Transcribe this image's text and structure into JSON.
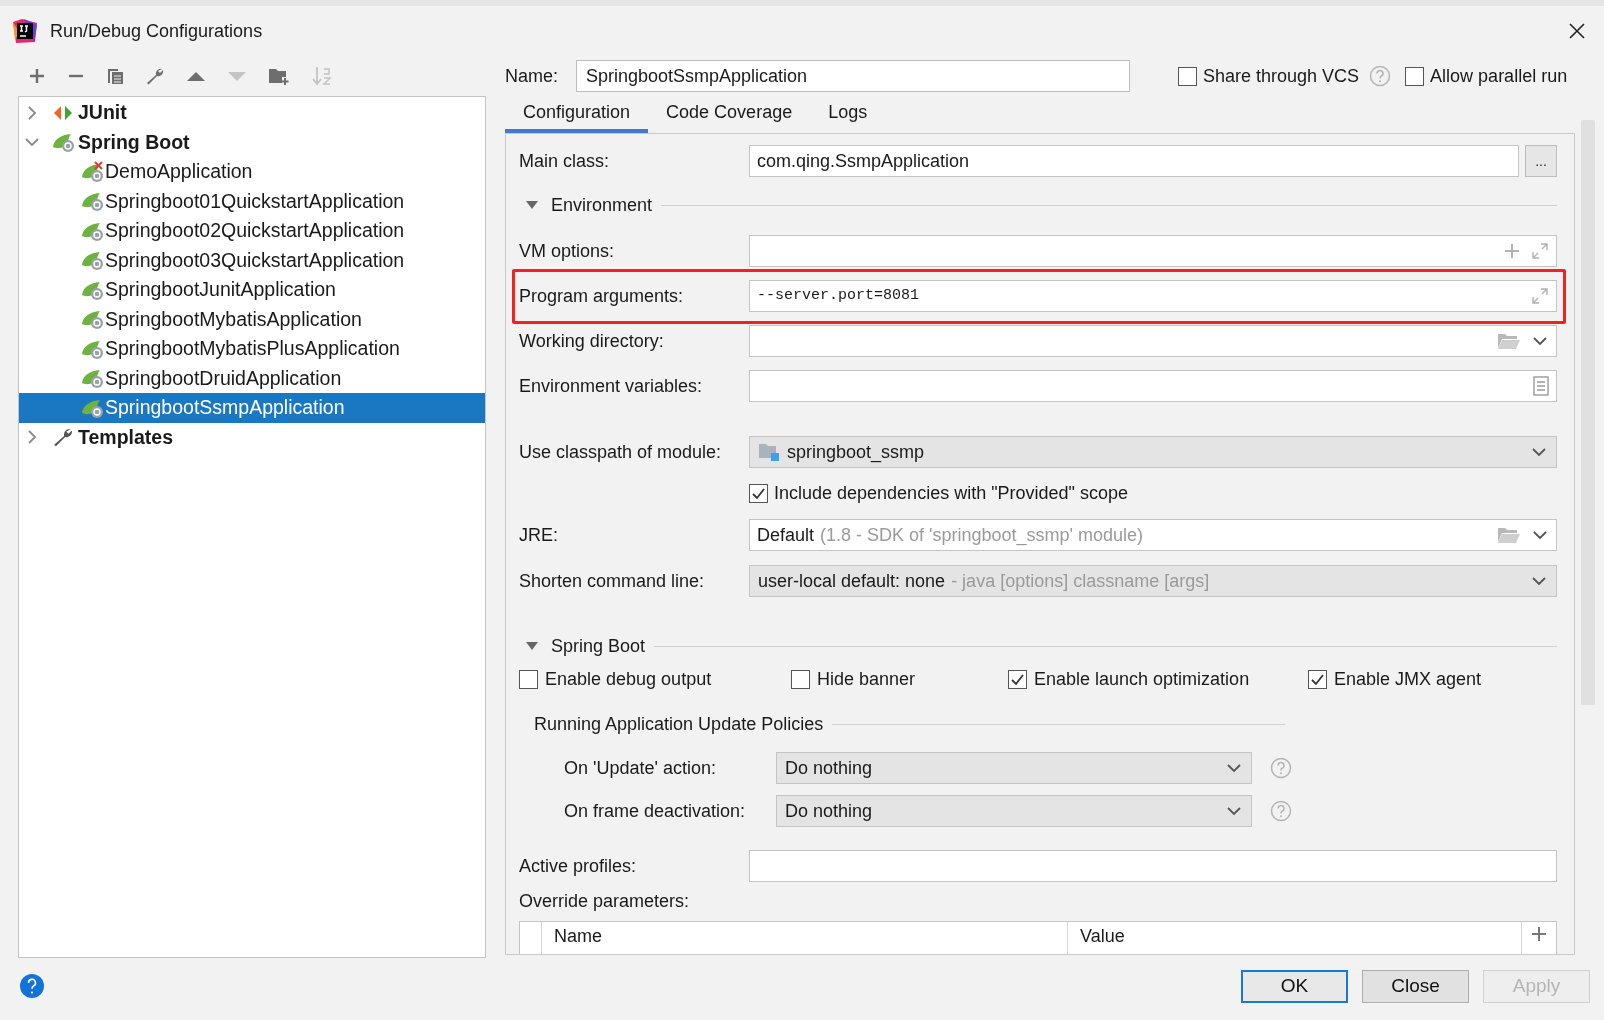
{
  "window": {
    "title": "Run/Debug Configurations"
  },
  "toolbar": [
    {
      "kind": "add",
      "disabled": false
    },
    {
      "kind": "remove",
      "disabled": false
    },
    {
      "kind": "copy",
      "disabled": false
    },
    {
      "kind": "edit",
      "disabled": false
    },
    {
      "kind": "up",
      "disabled": false
    },
    {
      "kind": "down",
      "disabled": true
    },
    {
      "kind": "folder",
      "disabled": false
    },
    {
      "kind": "sort",
      "disabled": true
    }
  ],
  "tree": [
    {
      "label": "JUnit",
      "kind": "junit",
      "expanded": false,
      "selected": false
    },
    {
      "label": "Spring Boot",
      "kind": "spring",
      "expanded": true,
      "selected": false,
      "children": [
        {
          "label": "DemoApplication",
          "error": true,
          "selected": false
        },
        {
          "label": "Springboot01QuickstartApplication",
          "error": false,
          "selected": false
        },
        {
          "label": "Springboot02QuickstartApplication",
          "error": false,
          "selected": false
        },
        {
          "label": "Springboot03QuickstartApplication",
          "error": false,
          "selected": false
        },
        {
          "label": "SpringbootJunitApplication",
          "error": false,
          "selected": false
        },
        {
          "label": "SpringbootMybatisApplication",
          "error": false,
          "selected": false
        },
        {
          "label": "SpringbootMybatisPlusApplication",
          "error": false,
          "selected": false
        },
        {
          "label": "SpringbootDruidApplication",
          "error": false,
          "selected": false
        },
        {
          "label": "SpringbootSsmpApplication",
          "error": false,
          "selected": true
        }
      ]
    },
    {
      "label": "Templates",
      "kind": "templates",
      "expanded": false,
      "selected": false
    }
  ],
  "name": {
    "label": "Name:",
    "value": "SpringbootSsmpApplication"
  },
  "options": [
    {
      "label": "Share through VCS",
      "checked": false,
      "help": true
    },
    {
      "label": "Allow parallel run",
      "checked": false,
      "help": false
    }
  ],
  "tabs": [
    {
      "label": "Configuration",
      "selected": true
    },
    {
      "label": "Code Coverage",
      "selected": false
    },
    {
      "label": "Logs",
      "selected": false
    }
  ],
  "fields": [
    {
      "kind": "text",
      "label": "Main class:",
      "value": "com.qing.SsmpApplication",
      "button": "..."
    },
    {
      "kind": "section",
      "label": "Environment",
      "expanded": true
    },
    {
      "kind": "vm",
      "label": "VM options:"
    },
    {
      "kind": "args",
      "label": "Program arguments:",
      "value": "--server.port=8081",
      "highlighted": true
    },
    {
      "kind": "dir",
      "label": "Working directory:"
    },
    {
      "kind": "env",
      "label": "Environment variables:"
    },
    {
      "kind": "module",
      "label": "Use classpath of module:",
      "value": "springboot_ssmp"
    },
    {
      "kind": "check",
      "label": "Include dependencies with \"Provided\" scope",
      "checked": true
    },
    {
      "kind": "jre",
      "label": "JRE:",
      "value": "Default",
      "hint": "(1.8 - SDK of 'springboot_ssmp' module)"
    },
    {
      "kind": "shorten",
      "label": "Shorten command line:",
      "value": "user-local default: none",
      "hint": "- java [options] classname [args]"
    },
    {
      "kind": "section",
      "label": "Spring Boot",
      "expanded": true
    },
    {
      "kind": "checks",
      "items": [
        {
          "label": "Enable debug output",
          "checked": false
        },
        {
          "label": "Hide banner",
          "checked": false
        },
        {
          "label": "Enable launch optimization",
          "checked": true
        },
        {
          "label": "Enable JMX agent",
          "checked": true
        }
      ]
    },
    {
      "kind": "subsection",
      "label": "Running Application Update Policies"
    },
    {
      "kind": "policy",
      "label": "On 'Update' action:",
      "value": "Do nothing"
    },
    {
      "kind": "policy",
      "label": "On frame deactivation:",
      "value": "Do nothing"
    },
    {
      "kind": "profiles",
      "label": "Active profiles:"
    },
    {
      "kind": "label",
      "label": "Override parameters:"
    },
    {
      "kind": "table",
      "columns": [
        "Name",
        "Value"
      ]
    }
  ],
  "buttons": [
    {
      "label": "OK",
      "default": true,
      "disabled": false
    },
    {
      "label": "Close",
      "default": false,
      "disabled": false
    },
    {
      "label": "Apply",
      "default": false,
      "disabled": true
    }
  ]
}
